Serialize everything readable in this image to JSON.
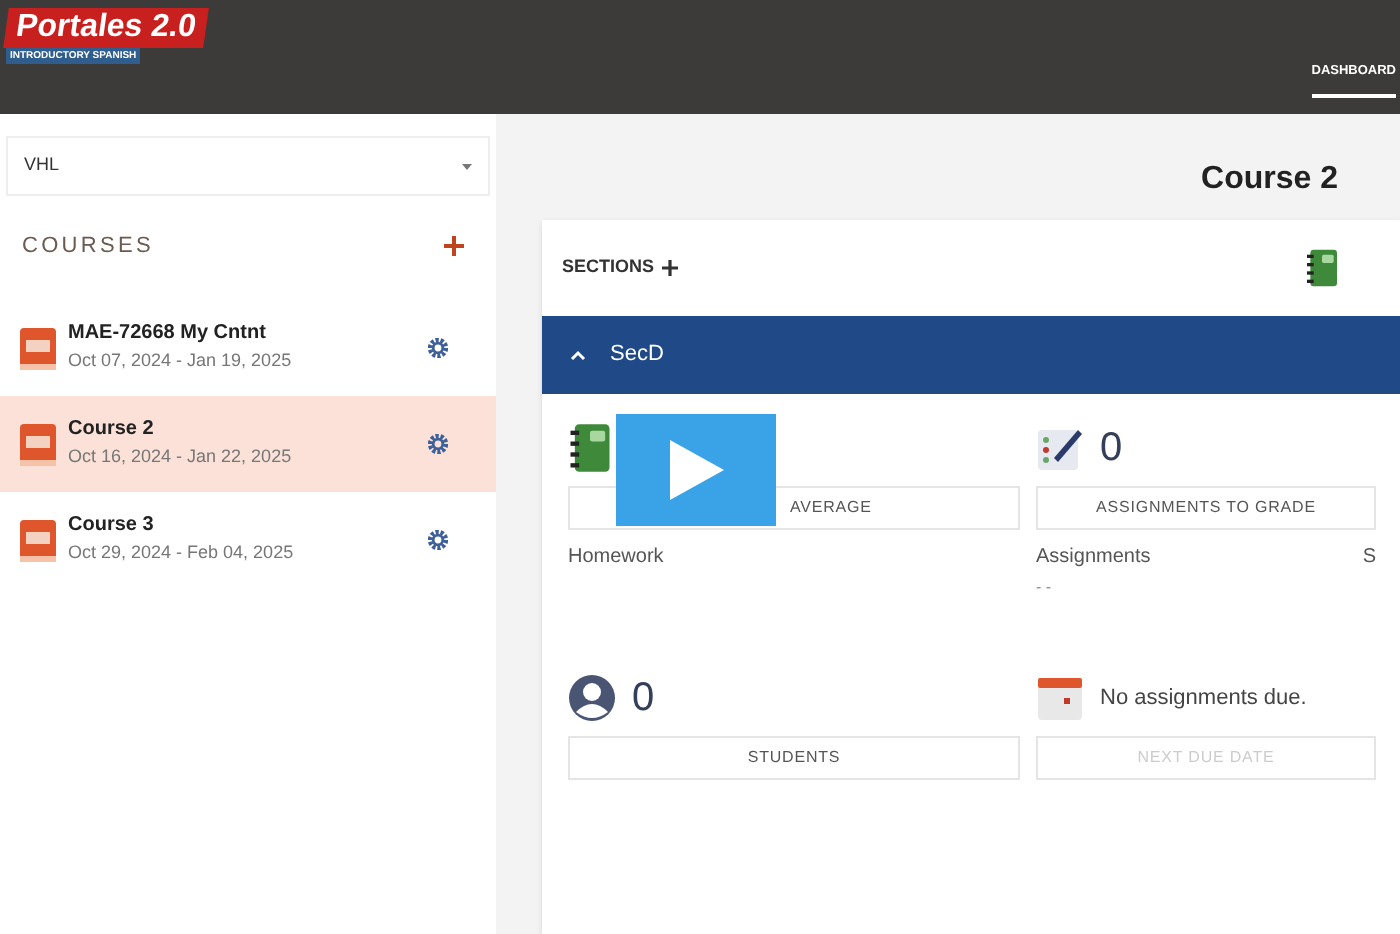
{
  "header": {
    "logo_title": "Portales 2.0",
    "logo_subtitle": "INTRODUCTORY SPANISH",
    "nav": [
      {
        "label": "DASHBOARD",
        "selected": true
      }
    ]
  },
  "sidebar": {
    "select": {
      "value": "VHL"
    },
    "heading": "COURSES",
    "courses": [
      {
        "name": "MAE-72668 My Cntnt",
        "dates": "Oct 07, 2024 - Jan 19, 2025",
        "selected": false
      },
      {
        "name": "Course 2",
        "dates": "Oct 16, 2024 - Jan 22, 2025",
        "selected": true
      },
      {
        "name": "Course 3",
        "dates": "Oct 29, 2024 - Feb 04, 2025",
        "selected": false
      }
    ]
  },
  "main": {
    "title": "Course 2",
    "sections_label": "SECTIONS",
    "section": {
      "name": "SecD",
      "expanded": true
    },
    "tiles": [
      {
        "kind": "video",
        "label": "AVERAGE",
        "caption": "Homework"
      },
      {
        "kind": "grade",
        "value": "0",
        "label": "ASSIGNMENTS TO GRADE",
        "caption": "Assignments",
        "sub": "- -",
        "extra": "S"
      },
      {
        "kind": "students",
        "value": "0",
        "label": "STUDENTS"
      },
      {
        "kind": "due",
        "value": "No assignments due.",
        "label": "NEXT DUE DATE"
      }
    ]
  }
}
